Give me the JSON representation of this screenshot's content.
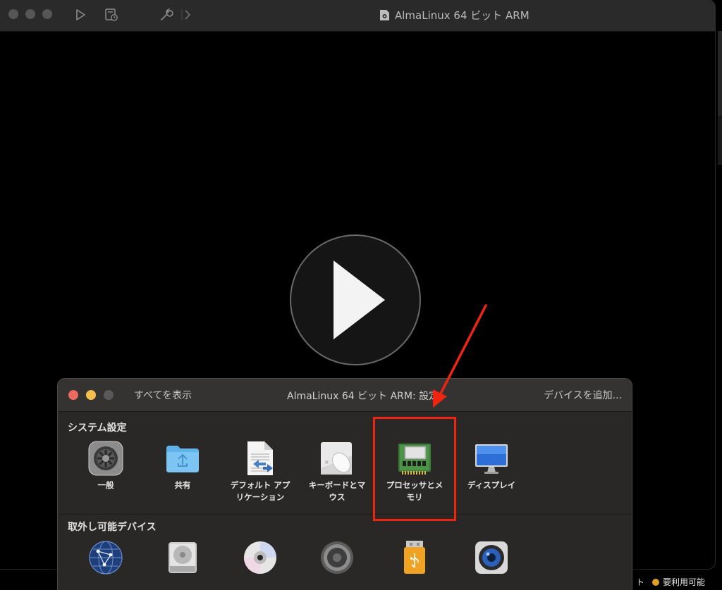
{
  "vm_window": {
    "title": "AlmaLinux 64 ビット ARM"
  },
  "settings": {
    "show_all": "すべてを表示",
    "title": "AlmaLinux 64 ビット ARM: 設定",
    "add_device": "デバイスを追加...",
    "system_section": {
      "heading": "システム設定",
      "items": [
        {
          "label": "一般",
          "icon": "gear-icon"
        },
        {
          "label": "共有",
          "icon": "folder-share-icon"
        },
        {
          "label": "デフォルト アプ\nリケーション",
          "icon": "default-app-icon"
        },
        {
          "label": "キーボードとマ\nウス",
          "icon": "keyboard-mouse-icon"
        },
        {
          "label": "プロセッサとメ\nモリ",
          "icon": "processor-memory-icon"
        },
        {
          "label": "ディスプレイ",
          "icon": "display-icon"
        }
      ]
    },
    "removable_section": {
      "heading": "取外し可能デバイス",
      "items": [
        {
          "icon": "network-globe-icon"
        },
        {
          "icon": "hard-disk-icon"
        },
        {
          "icon": "cd-dvd-icon"
        },
        {
          "icon": "speaker-icon"
        },
        {
          "icon": "usb-icon"
        },
        {
          "icon": "camera-icon"
        }
      ]
    }
  },
  "annotation": {
    "color": "#ef2512"
  },
  "background_right_text": {
    "status": "要利用可能"
  }
}
